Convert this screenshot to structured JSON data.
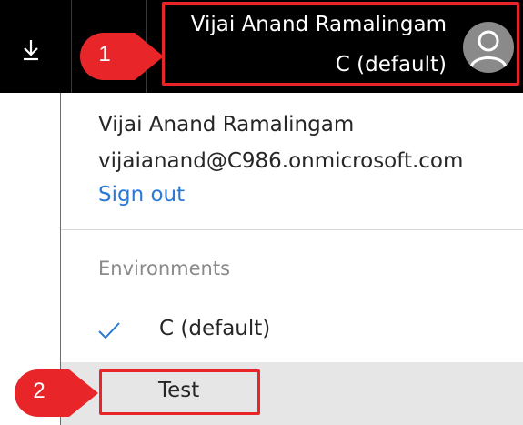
{
  "header": {
    "download_icon": "download-arrow-icon",
    "account": {
      "name": "Vijai Anand Ramalingam",
      "environment": "C (default)",
      "avatar_icon": "user-avatar-icon"
    }
  },
  "account_menu": {
    "user_name": "Vijai Anand Ramalingam",
    "email": "vijaianand@C986.onmicrosoft.com",
    "sign_out_label": "Sign out",
    "environments_heading": "Environments",
    "environments": [
      {
        "label": "C (default)",
        "selected": true,
        "icon": "checkmark-icon"
      },
      {
        "label": "Test",
        "selected": false,
        "highlighted": true
      }
    ]
  },
  "annotations": [
    {
      "number": "1"
    },
    {
      "number": "2"
    }
  ],
  "colors": {
    "topbar": "#000000",
    "link": "#2b79d6",
    "annotation_red": "#e8262a",
    "hover_row": "#e6e6e6",
    "muted_text": "#8a8a8a"
  }
}
